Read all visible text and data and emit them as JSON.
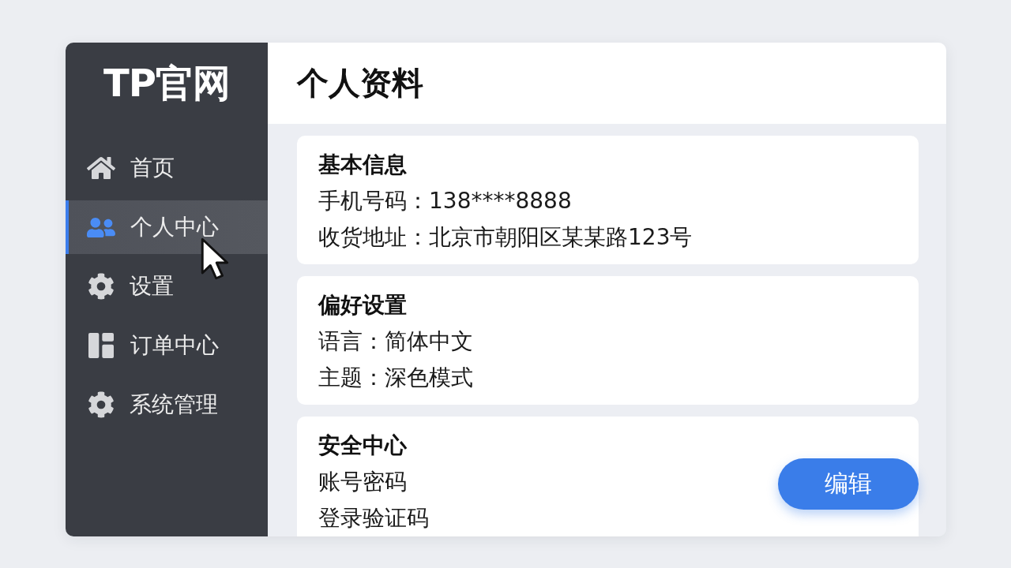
{
  "sidebar": {
    "logo": "TP官网",
    "items": [
      {
        "label": "首页",
        "kind": "home",
        "selected": false
      },
      {
        "label": "个人中心",
        "kind": "users",
        "selected": true
      },
      {
        "label": "设置",
        "kind": "gear",
        "selected": false
      },
      {
        "label": "订单中心",
        "kind": "layout",
        "selected": false
      },
      {
        "label": "系统管理",
        "kind": "gear",
        "selected": false
      }
    ]
  },
  "header": {
    "title": "个人资料"
  },
  "sections": [
    {
      "title": "基本信息",
      "lines": [
        "手机号码：138****8888",
        "收货地址：北京市朝阳区某某路123号"
      ]
    },
    {
      "title": "偏好设置",
      "lines": [
        "语言：简体中文",
        "主题：深色模式"
      ]
    },
    {
      "title": "安全中心",
      "lines": [
        "账号密码",
        "登录验证码"
      ],
      "button": "编辑"
    }
  ]
}
